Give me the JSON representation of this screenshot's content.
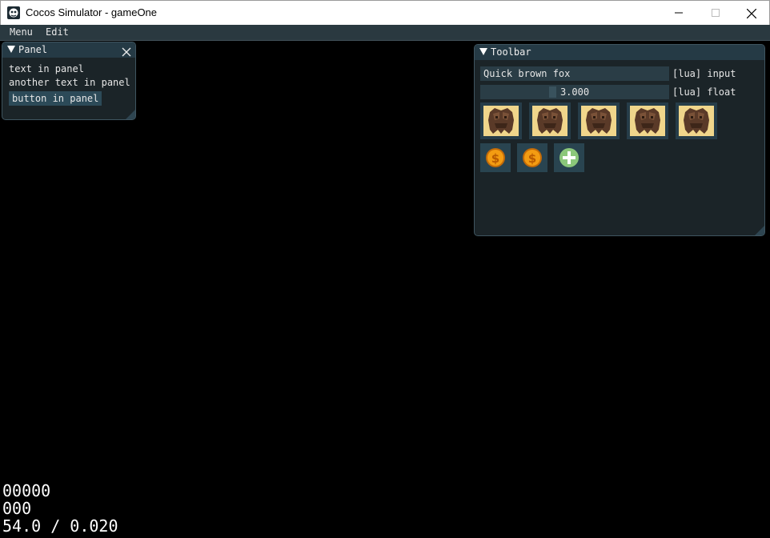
{
  "window": {
    "title": "Cocos Simulator - gameOne"
  },
  "menubar": {
    "items": [
      "Menu",
      "Edit"
    ]
  },
  "panel": {
    "title": "Panel",
    "lines": [
      "text in panel",
      "another text in panel"
    ],
    "button_label": "button in panel"
  },
  "toolbar": {
    "title": "Toolbar",
    "input_value": "Quick brown fox",
    "input_label": "[lua] input",
    "float_value": "3.000",
    "float_label": "[lua] float",
    "image_buttons": [
      "treant-icon",
      "treant-icon",
      "treant-icon",
      "treant-icon",
      "treant-icon"
    ],
    "icon_buttons": [
      "coin-icon",
      "coin-icon",
      "plus-icon"
    ]
  },
  "stats": {
    "line1": "00000",
    "line2": "000",
    "line3": "54.0 / 0.020"
  },
  "colors": {
    "accent": "#253a45",
    "window_bg": "#1b2428",
    "field_bg": "#2a3d46",
    "tile_bg": "#f0d68b"
  }
}
